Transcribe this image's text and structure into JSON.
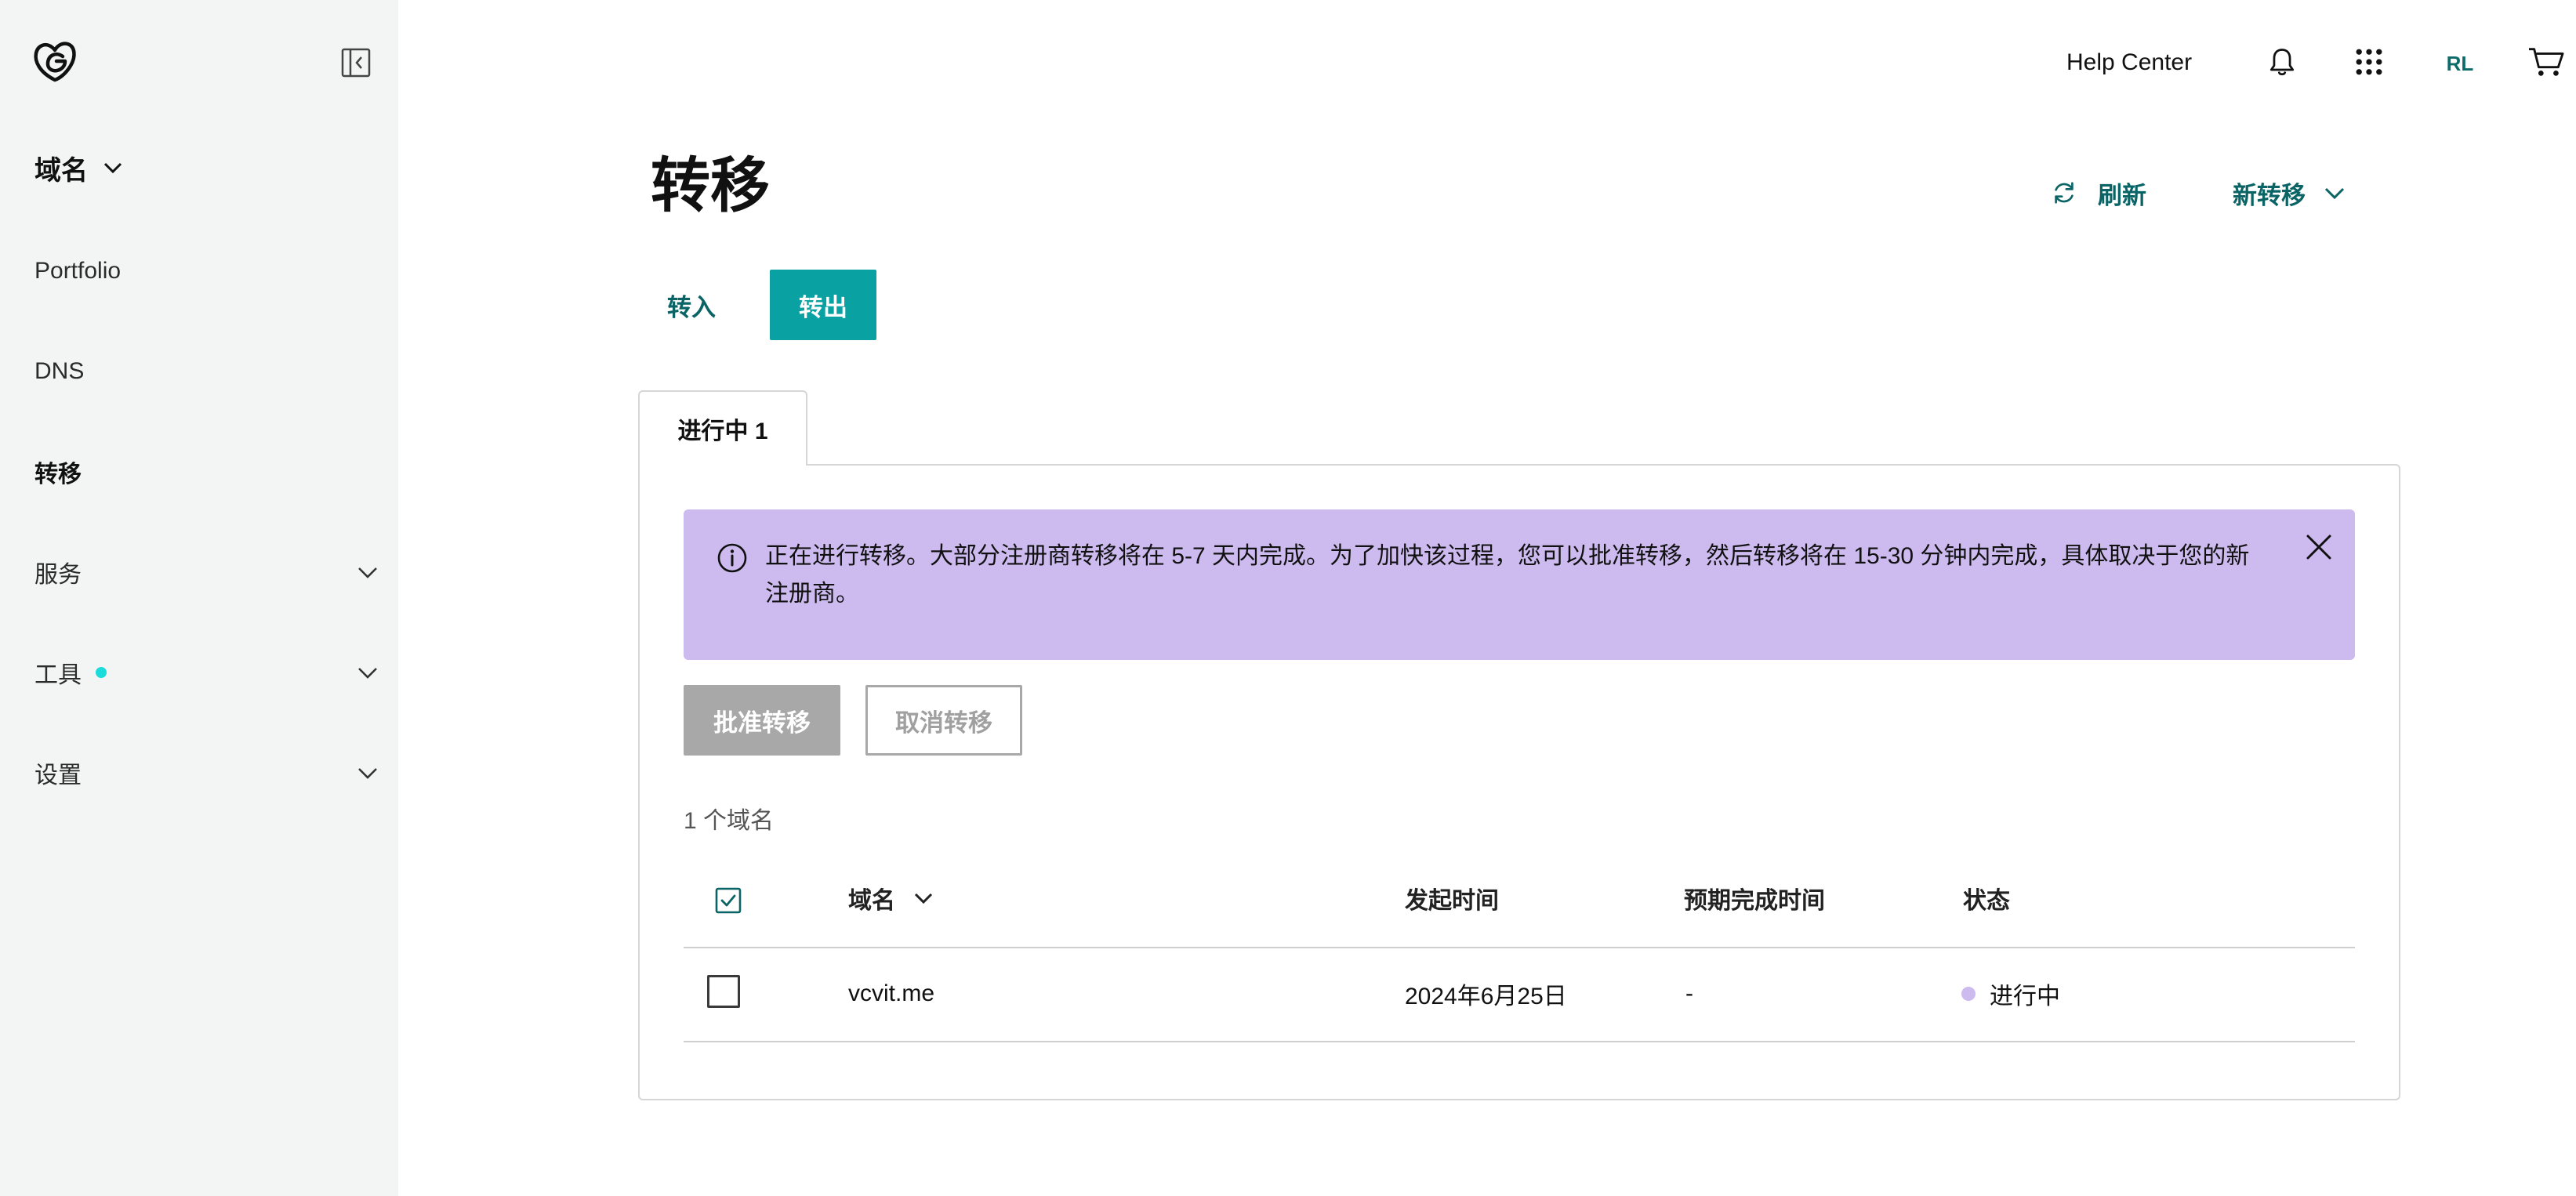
{
  "sidebar": {
    "domain_menu_label": "域名",
    "items": [
      {
        "label": "Portfolio"
      },
      {
        "label": "DNS"
      },
      {
        "label": "转移"
      },
      {
        "label": "服务"
      },
      {
        "label": "工具"
      },
      {
        "label": "设置"
      }
    ]
  },
  "topbar": {
    "help_center": "Help Center",
    "avatar_initials": "RL"
  },
  "page": {
    "title": "转移",
    "refresh_label": "刷新",
    "new_transfer_label": "新转移"
  },
  "segments": {
    "transfer_in": "转入",
    "transfer_out": "转出",
    "selected": "转出"
  },
  "tab": {
    "label": "进行中 1"
  },
  "alert": {
    "text": "正在进行转移。大部分注册商转移将在 5-7 天内完成。为了加快该过程，您可以批准转移，然后转移将在 15-30 分钟内完成，具体取决于您的新注册商。"
  },
  "actions": {
    "approve": "批准转移",
    "cancel": "取消转移"
  },
  "table": {
    "count_label": "1 个域名",
    "headers": {
      "domain": "域名",
      "initiated": "发起时间",
      "expected": "预期完成时间",
      "status": "状态"
    },
    "rows": [
      {
        "domain": "vcvit.me",
        "initiated": "2024年6月25日",
        "expected": "-",
        "status": "进行中"
      }
    ]
  },
  "colors": {
    "accent": "#09a1a1",
    "link": "#0a6465",
    "alert_bg": "#cdbbf0",
    "sidebar_bg": "#f3f5f5",
    "tool_dot": "#1bdbdb"
  }
}
